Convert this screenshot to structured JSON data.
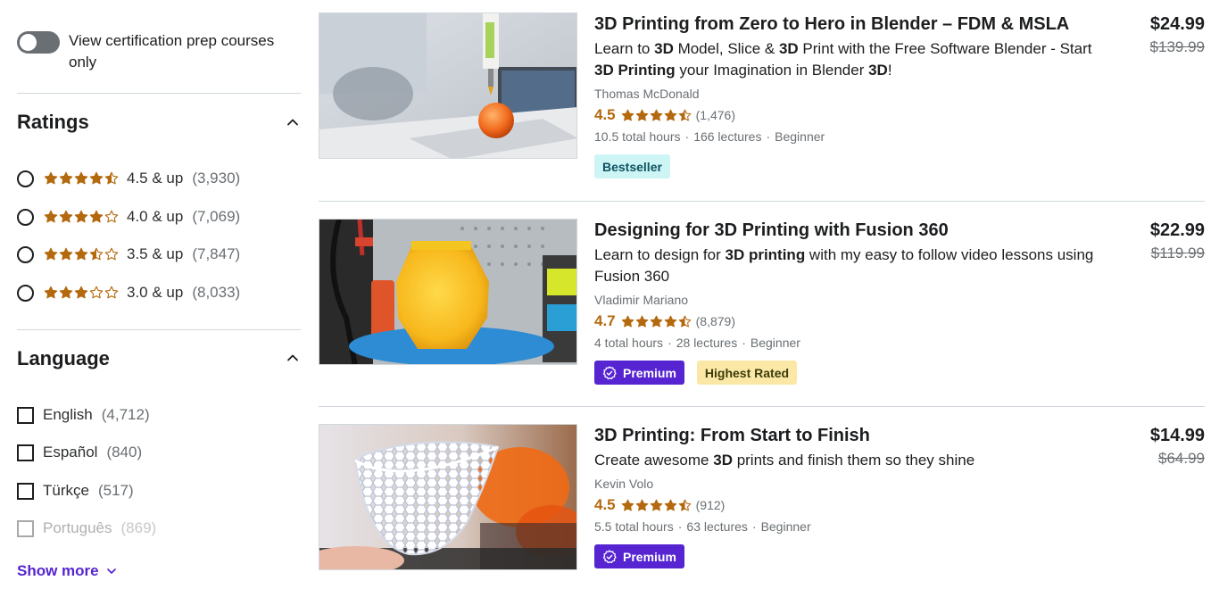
{
  "filters": {
    "cert_toggle_label": "View certification prep courses only",
    "ratings": {
      "title": "Ratings",
      "options": [
        {
          "label": "4.5 & up",
          "count": "(3,930)",
          "stars": 4.5
        },
        {
          "label": "4.0 & up",
          "count": "(7,069)",
          "stars": 4.0
        },
        {
          "label": "3.5 & up",
          "count": "(7,847)",
          "stars": 3.5
        },
        {
          "label": "3.0 & up",
          "count": "(8,033)",
          "stars": 3.0
        }
      ]
    },
    "language": {
      "title": "Language",
      "options": [
        {
          "name": "English",
          "count": "(4,712)"
        },
        {
          "name": "Español",
          "count": "(840)"
        },
        {
          "name": "Türkçe",
          "count": "(517)"
        },
        {
          "name": "Português",
          "count": "(869)"
        }
      ],
      "show_more": "Show more"
    }
  },
  "courses": [
    {
      "title": "3D Printing from Zero to Hero in Blender – FDM & MSLA",
      "description_parts": [
        {
          "t": "Learn to ",
          "b": false
        },
        {
          "t": "3D",
          "b": true
        },
        {
          "t": " Model, Slice & ",
          "b": false
        },
        {
          "t": "3D",
          "b": true
        },
        {
          "t": " Print with the Free Software Blender - Start ",
          "b": false
        },
        {
          "t": "3D Printing",
          "b": true
        },
        {
          "t": " your Imagination in Blender ",
          "b": false
        },
        {
          "t": "3D",
          "b": true
        },
        {
          "t": "!",
          "b": false
        }
      ],
      "author": "Thomas McDonald",
      "rating": "4.5",
      "stars": 4.5,
      "reviews": "(1,476)",
      "hours": "10.5 total hours",
      "lectures": "166 lectures",
      "level": "Beginner",
      "badges": [
        "Bestseller"
      ],
      "price": "$24.99",
      "original_price": "$139.99"
    },
    {
      "title": "Designing for 3D Printing with Fusion 360",
      "description_parts": [
        {
          "t": "Learn to design for ",
          "b": false
        },
        {
          "t": "3D printing",
          "b": true
        },
        {
          "t": " with my easy to follow video lessons using Fusion 360",
          "b": false
        }
      ],
      "author": "Vladimir Mariano",
      "rating": "4.7",
      "stars": 4.5,
      "reviews": "(8,879)",
      "hours": "4 total hours",
      "lectures": "28 lectures",
      "level": "Beginner",
      "badges": [
        "Premium",
        "Highest Rated"
      ],
      "price": "$22.99",
      "original_price": "$119.99"
    },
    {
      "title": "3D Printing: From Start to Finish",
      "description_parts": [
        {
          "t": "Create awesome ",
          "b": false
        },
        {
          "t": "3D",
          "b": true
        },
        {
          "t": " prints and finish them so they shine",
          "b": false
        }
      ],
      "author": "Kevin Volo",
      "rating": "4.5",
      "stars": 4.5,
      "reviews": "(912)",
      "hours": "5.5 total hours",
      "lectures": "63 lectures",
      "level": "Beginner",
      "badges": [
        "Premium"
      ],
      "price": "$14.99",
      "original_price": "$64.99"
    }
  ],
  "colors": {
    "star": "#b4690e",
    "accent": "#5624d0",
    "bestseller_bg": "#cdf5f5",
    "highest_rated_bg": "#fbe8a6"
  }
}
